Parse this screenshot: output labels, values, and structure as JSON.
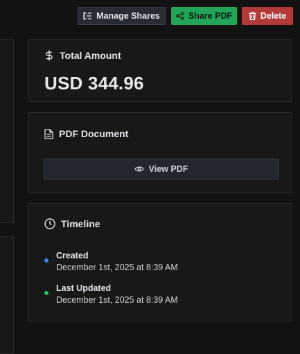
{
  "toolbar": {
    "manage_shares_label": "Manage Shares",
    "share_pdf_label": "Share PDF",
    "delete_label": "Delete"
  },
  "total_card": {
    "title": "Total Amount",
    "amount": "USD 344.96"
  },
  "pdf_card": {
    "title": "PDF Document",
    "view_label": "View PDF"
  },
  "timeline_card": {
    "title": "Timeline",
    "events": [
      {
        "label": "Created",
        "date": "December 1st, 2025 at 8:39 AM",
        "color": "#3b82f6"
      },
      {
        "label": "Last Updated",
        "date": "December 1st, 2025 at 8:39 AM",
        "color": "#22c55e"
      }
    ]
  },
  "colors": {
    "background": "#121212",
    "card": "#181818",
    "share": "#22a55a",
    "delete": "#b23a3a"
  },
  "icons": {
    "manage_shares": "list-filter-icon",
    "share_pdf": "share-icon",
    "delete": "trash-icon",
    "total": "dollar-icon",
    "pdf": "file-text-icon",
    "view": "eye-icon",
    "timeline": "clock-icon"
  }
}
